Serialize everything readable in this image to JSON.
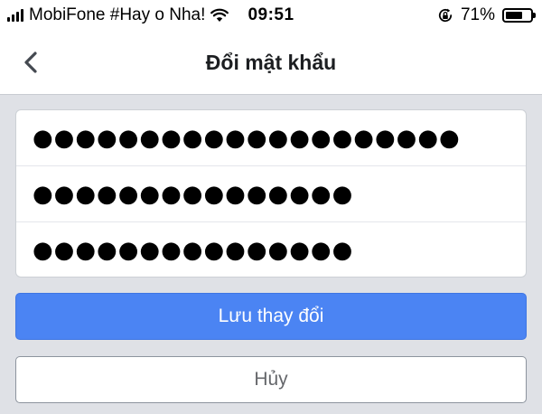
{
  "status_bar": {
    "carrier": "MobiFone #Hay o Nha!",
    "time": "09:51",
    "battery_percent": "71%",
    "battery_level": 0.71,
    "icons": [
      "signal-bars-icon",
      "wifi-icon",
      "orientation-lock-icon",
      "battery-icon"
    ]
  },
  "nav": {
    "title": "Đổi mật khẩu",
    "back_icon": "chevron-left-icon"
  },
  "form": {
    "fields": [
      {
        "value": "●●●●●●●●●●●●●●●●●●●●"
      },
      {
        "value": "●●●●●●●●●●●●●●●"
      },
      {
        "value": "●●●●●●●●●●●●●●●"
      }
    ]
  },
  "actions": {
    "save_label": "Lưu thay đổi",
    "cancel_label": "Hủy"
  },
  "colors": {
    "primary": "#4b84f3",
    "background": "#dfe1e6",
    "cancel_text": "#65676b"
  }
}
